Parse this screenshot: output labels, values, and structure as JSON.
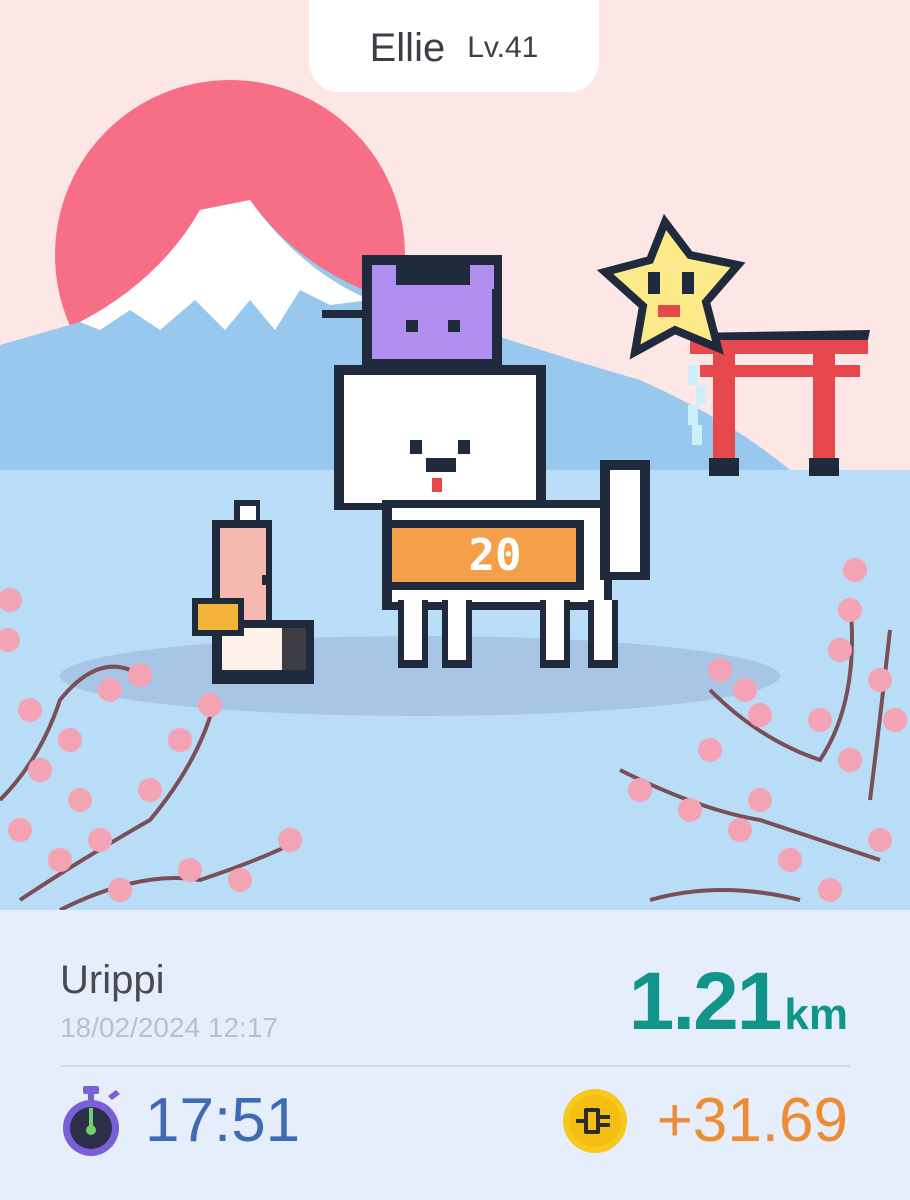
{
  "pet": {
    "name": "Ellie",
    "level": "Lv.41"
  },
  "scene": {
    "description_icons": [
      "rising-sun",
      "mount-fuji",
      "torii-gate",
      "cherry-blossom",
      "dog-pet",
      "cat-hat",
      "star-balloon",
      "character-companion"
    ],
    "badge_number": "20",
    "colors": {
      "sky": "#fde6e6",
      "sun": "#f76f86",
      "mountain": "#98c8ee",
      "lake": "#b9dcf7",
      "blossom": "#f4a3b4"
    }
  },
  "walk": {
    "route_name": "Urippi",
    "datetime": "18/02/2024 12:17",
    "distance_value": "1.21",
    "distance_unit": "km",
    "duration": "17:51",
    "earnings": "+31.69"
  },
  "icons": {
    "timer": "stopwatch-icon",
    "coin": "coin-icon"
  },
  "colors": {
    "distance": "#11958a",
    "duration": "#3f6bb3",
    "earnings": "#ee8b33",
    "card_bg": "#e7eefb"
  }
}
